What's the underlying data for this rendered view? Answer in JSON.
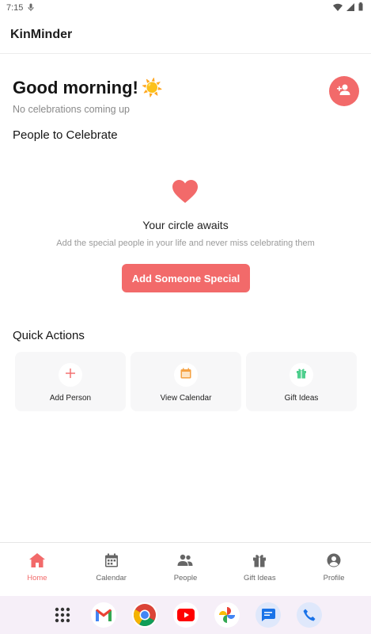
{
  "status_bar": {
    "time": "7:15"
  },
  "app_bar": {
    "title": "KinMinder"
  },
  "greeting": {
    "title": "Good morning!",
    "emoji": "☀️",
    "subtitle": "No celebrations coming up"
  },
  "people_section": {
    "title": "People to Celebrate",
    "empty_state": {
      "title": "Your circle awaits",
      "description": "Add the special people in your life and never miss celebrating them",
      "button_label": "Add Someone Special"
    }
  },
  "quick_actions": {
    "title": "Quick Actions",
    "items": [
      {
        "label": "Add Person",
        "icon": "plus-icon",
        "color": "#f26a6a"
      },
      {
        "label": "View Calendar",
        "icon": "calendar-icon",
        "color": "#f5a142"
      },
      {
        "label": "Gift Ideas",
        "icon": "gift-icon",
        "color": "#4fcf8e"
      }
    ]
  },
  "bottom_nav": {
    "active": "Home",
    "items": [
      {
        "label": "Home",
        "icon": "home-icon"
      },
      {
        "label": "Calendar",
        "icon": "calendar-icon"
      },
      {
        "label": "People",
        "icon": "people-icon"
      },
      {
        "label": "Gift Ideas",
        "icon": "gift-icon"
      },
      {
        "label": "Profile",
        "icon": "profile-icon"
      }
    ]
  },
  "dock": {
    "apps": [
      "app-drawer-icon",
      "gmail-icon",
      "chrome-icon",
      "youtube-icon",
      "photos-icon",
      "messages-icon",
      "phone-icon"
    ]
  },
  "colors": {
    "accent": "#f26a6a",
    "nav_inactive": "#666666"
  }
}
